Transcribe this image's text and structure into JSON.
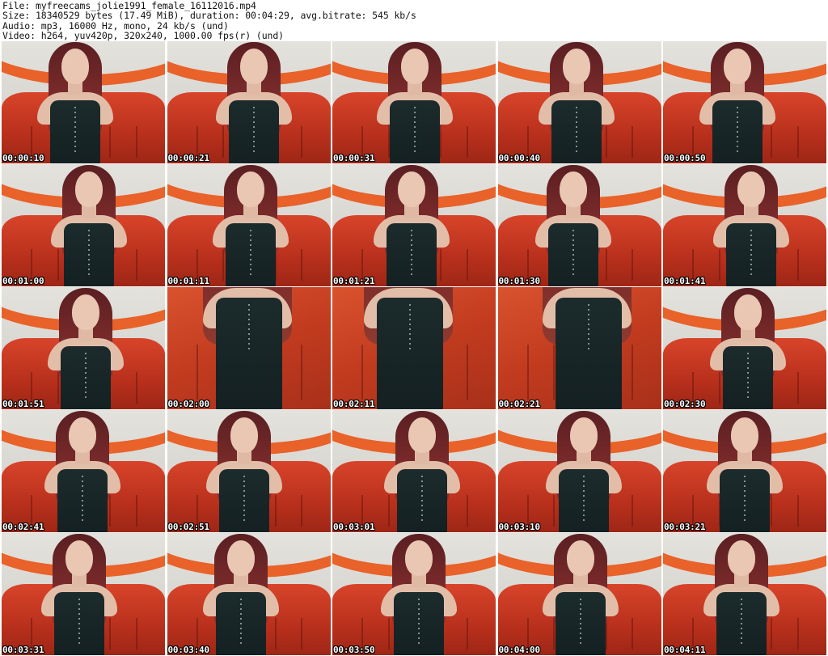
{
  "header": {
    "file_line": "File: myfreecams_jolie1991_female_16112016.mp4",
    "size_line": "Size: 18340529 bytes (17.49 MiB), duration: 00:04:29, avg.bitrate: 545 kb/s",
    "audio_line": "Audio: mp3, 16000 Hz, mono, 24 kb/s (und)",
    "video_line": "Video: h264, yuv420p, 320x240, 1000.00 fps(r) (und)"
  },
  "thumbnails": [
    {
      "timestamp": "00:00:10",
      "variant": "standard"
    },
    {
      "timestamp": "00:00:21",
      "variant": "standard"
    },
    {
      "timestamp": "00:00:31",
      "variant": "standard"
    },
    {
      "timestamp": "00:00:40",
      "variant": "standard"
    },
    {
      "timestamp": "00:00:50",
      "variant": "standard"
    },
    {
      "timestamp": "00:01:00",
      "variant": "standard"
    },
    {
      "timestamp": "00:01:11",
      "variant": "standard"
    },
    {
      "timestamp": "00:01:21",
      "variant": "standard"
    },
    {
      "timestamp": "00:01:30",
      "variant": "standard"
    },
    {
      "timestamp": "00:01:41",
      "variant": "standard"
    },
    {
      "timestamp": "00:01:51",
      "variant": "standard"
    },
    {
      "timestamp": "00:02:00",
      "variant": "closeup"
    },
    {
      "timestamp": "00:02:11",
      "variant": "closeup"
    },
    {
      "timestamp": "00:02:21",
      "variant": "closeup"
    },
    {
      "timestamp": "00:02:30",
      "variant": "standard"
    },
    {
      "timestamp": "00:02:41",
      "variant": "standard"
    },
    {
      "timestamp": "00:02:51",
      "variant": "standard"
    },
    {
      "timestamp": "00:03:01",
      "variant": "standard"
    },
    {
      "timestamp": "00:03:10",
      "variant": "standard"
    },
    {
      "timestamp": "00:03:21",
      "variant": "standard"
    },
    {
      "timestamp": "00:03:31",
      "variant": "standard"
    },
    {
      "timestamp": "00:03:40",
      "variant": "standard"
    },
    {
      "timestamp": "00:03:50",
      "variant": "standard"
    },
    {
      "timestamp": "00:04:00",
      "variant": "standard"
    },
    {
      "timestamp": "00:04:11",
      "variant": "standard"
    }
  ],
  "colors": {
    "wall": "#dcdad5",
    "wall_arc": "#e8622a",
    "sofa": "#c23b1f",
    "hair": "#7a2a2a",
    "dress": "#1c2b2c",
    "timestamp_text": "#ffffff"
  }
}
